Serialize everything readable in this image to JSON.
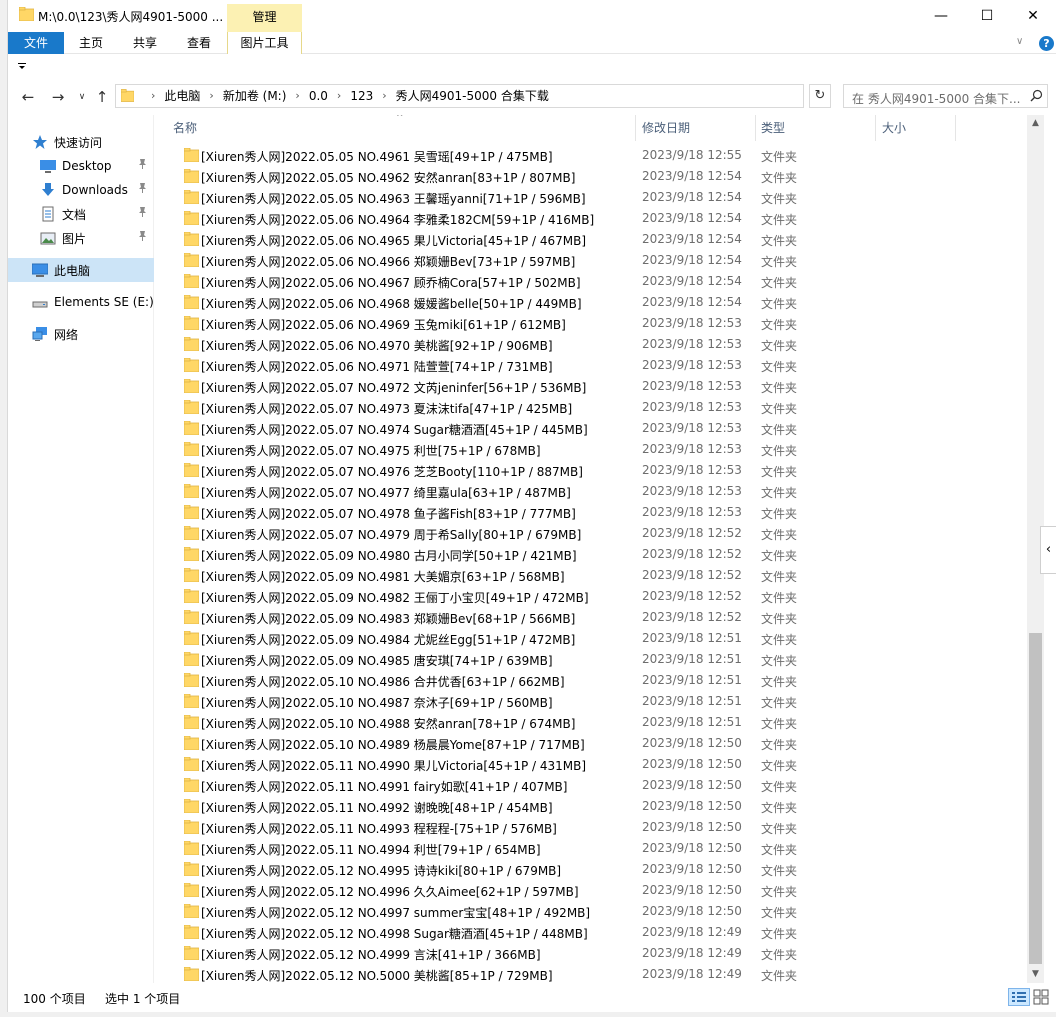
{
  "window": {
    "title": "M:\\0.0\\123\\秀人网4901-5000 ...",
    "manage_tab": "管理",
    "min": "—",
    "max": "☐",
    "close": "✕"
  },
  "ribbon": {
    "tabs": [
      "文件",
      "主页",
      "共享",
      "查看",
      "图片工具"
    ],
    "expand": "∨",
    "help": "?"
  },
  "nav": {
    "back": "←",
    "forward": "→",
    "recent": "∨",
    "up": "↑",
    "crumbs": [
      "此电脑",
      "新加卷 (M:)",
      "0.0",
      "123",
      "秀人网4901-5000 合集下载"
    ],
    "separator": "›",
    "refresh": "↻",
    "search_placeholder": "在 秀人网4901-5000 合集下..."
  },
  "sidebar": {
    "items": [
      {
        "label": "快速访问",
        "icon": "star-icon"
      },
      {
        "label": "Desktop",
        "icon": "desktop-icon"
      },
      {
        "label": "Downloads",
        "icon": "download-icon"
      },
      {
        "label": "文档",
        "icon": "document-icon"
      },
      {
        "label": "图片",
        "icon": "picture-icon"
      },
      {
        "label": "此电脑",
        "icon": "computer-icon"
      },
      {
        "label": "Elements SE (E:)",
        "icon": "drive-icon"
      },
      {
        "label": "网络",
        "icon": "network-icon"
      }
    ]
  },
  "columns": {
    "name": "名称",
    "date": "修改日期",
    "type": "类型",
    "size": "大小",
    "sort_indicator": "^"
  },
  "files": [
    {
      "name": "[Xiuren秀人网]2022.05.05 NO.4961 吴雪瑶[49+1P / 475MB]",
      "date": "2023/9/18 12:55",
      "type": "文件夹"
    },
    {
      "name": "[Xiuren秀人网]2022.05.05 NO.4962 安然anran[83+1P / 807MB]",
      "date": "2023/9/18 12:54",
      "type": "文件夹"
    },
    {
      "name": "[Xiuren秀人网]2022.05.05 NO.4963 王馨瑶yanni[71+1P / 596MB]",
      "date": "2023/9/18 12:54",
      "type": "文件夹"
    },
    {
      "name": "[Xiuren秀人网]2022.05.06 NO.4964 李雅柔182CM[59+1P / 416MB]",
      "date": "2023/9/18 12:54",
      "type": "文件夹"
    },
    {
      "name": "[Xiuren秀人网]2022.05.06 NO.4965 果儿Victoria[45+1P / 467MB]",
      "date": "2023/9/18 12:54",
      "type": "文件夹"
    },
    {
      "name": "[Xiuren秀人网]2022.05.06 NO.4966 郑颖姗Bev[73+1P / 597MB]",
      "date": "2023/9/18 12:54",
      "type": "文件夹"
    },
    {
      "name": "[Xiuren秀人网]2022.05.06 NO.4967 顾乔楠Cora[57+1P / 502MB]",
      "date": "2023/9/18 12:54",
      "type": "文件夹"
    },
    {
      "name": "[Xiuren秀人网]2022.05.06 NO.4968 媛媛酱belle[50+1P / 449MB]",
      "date": "2023/9/18 12:54",
      "type": "文件夹"
    },
    {
      "name": "[Xiuren秀人网]2022.05.06 NO.4969 玉兔miki[61+1P / 612MB]",
      "date": "2023/9/18 12:53",
      "type": "文件夹"
    },
    {
      "name": "[Xiuren秀人网]2022.05.06 NO.4970 美桃酱[92+1P / 906MB]",
      "date": "2023/9/18 12:53",
      "type": "文件夹"
    },
    {
      "name": "[Xiuren秀人网]2022.05.06 NO.4971 陆萱萱[74+1P / 731MB]",
      "date": "2023/9/18 12:53",
      "type": "文件夹"
    },
    {
      "name": "[Xiuren秀人网]2022.05.07 NO.4972 文芮jeninfer[56+1P / 536MB]",
      "date": "2023/9/18 12:53",
      "type": "文件夹"
    },
    {
      "name": "[Xiuren秀人网]2022.05.07 NO.4973 夏沫沫tifa[47+1P / 425MB]",
      "date": "2023/9/18 12:53",
      "type": "文件夹"
    },
    {
      "name": "[Xiuren秀人网]2022.05.07 NO.4974 Sugar糖酒酒[45+1P / 445MB]",
      "date": "2023/9/18 12:53",
      "type": "文件夹"
    },
    {
      "name": "[Xiuren秀人网]2022.05.07 NO.4975 利世[75+1P / 678MB]",
      "date": "2023/9/18 12:53",
      "type": "文件夹"
    },
    {
      "name": "[Xiuren秀人网]2022.05.07 NO.4976 芝芝Booty[110+1P / 887MB]",
      "date": "2023/9/18 12:53",
      "type": "文件夹"
    },
    {
      "name": "[Xiuren秀人网]2022.05.07 NO.4977 绮里嘉ula[63+1P / 487MB]",
      "date": "2023/9/18 12:53",
      "type": "文件夹"
    },
    {
      "name": "[Xiuren秀人网]2022.05.07 NO.4978 鱼子酱Fish[83+1P / 777MB]",
      "date": "2023/9/18 12:53",
      "type": "文件夹"
    },
    {
      "name": "[Xiuren秀人网]2022.05.07 NO.4979 周于希Sally[80+1P / 679MB]",
      "date": "2023/9/18 12:52",
      "type": "文件夹"
    },
    {
      "name": "[Xiuren秀人网]2022.05.09 NO.4980 古月小同学[50+1P / 421MB]",
      "date": "2023/9/18 12:52",
      "type": "文件夹"
    },
    {
      "name": "[Xiuren秀人网]2022.05.09 NO.4981 大美媚京[63+1P / 568MB]",
      "date": "2023/9/18 12:52",
      "type": "文件夹"
    },
    {
      "name": "[Xiuren秀人网]2022.05.09 NO.4982 王俪丁小宝贝[49+1P / 472MB]",
      "date": "2023/9/18 12:52",
      "type": "文件夹"
    },
    {
      "name": "[Xiuren秀人网]2022.05.09 NO.4983 郑颖姗Bev[68+1P / 566MB]",
      "date": "2023/9/18 12:52",
      "type": "文件夹"
    },
    {
      "name": "[Xiuren秀人网]2022.05.09 NO.4984 尤妮丝Egg[51+1P / 472MB]",
      "date": "2023/9/18 12:51",
      "type": "文件夹"
    },
    {
      "name": "[Xiuren秀人网]2022.05.09 NO.4985 唐安琪[74+1P / 639MB]",
      "date": "2023/9/18 12:51",
      "type": "文件夹"
    },
    {
      "name": "[Xiuren秀人网]2022.05.10 NO.4986 合井优香[63+1P / 662MB]",
      "date": "2023/9/18 12:51",
      "type": "文件夹"
    },
    {
      "name": "[Xiuren秀人网]2022.05.10 NO.4987 奈沐子[69+1P / 560MB]",
      "date": "2023/9/18 12:51",
      "type": "文件夹"
    },
    {
      "name": "[Xiuren秀人网]2022.05.10 NO.4988 安然anran[78+1P / 674MB]",
      "date": "2023/9/18 12:51",
      "type": "文件夹"
    },
    {
      "name": "[Xiuren秀人网]2022.05.10 NO.4989 杨晨晨Yome[87+1P / 717MB]",
      "date": "2023/9/18 12:50",
      "type": "文件夹"
    },
    {
      "name": "[Xiuren秀人网]2022.05.11 NO.4990 果儿Victoria[45+1P / 431MB]",
      "date": "2023/9/18 12:50",
      "type": "文件夹"
    },
    {
      "name": "[Xiuren秀人网]2022.05.11 NO.4991 fairy如歌[41+1P / 407MB]",
      "date": "2023/9/18 12:50",
      "type": "文件夹"
    },
    {
      "name": "[Xiuren秀人网]2022.05.11 NO.4992 谢晚晚[48+1P / 454MB]",
      "date": "2023/9/18 12:50",
      "type": "文件夹"
    },
    {
      "name": "[Xiuren秀人网]2022.05.11 NO.4993 程程程-[75+1P / 576MB]",
      "date": "2023/9/18 12:50",
      "type": "文件夹"
    },
    {
      "name": "[Xiuren秀人网]2022.05.11 NO.4994 利世[79+1P / 654MB]",
      "date": "2023/9/18 12:50",
      "type": "文件夹"
    },
    {
      "name": "[Xiuren秀人网]2022.05.12 NO.4995 诗诗kiki[80+1P / 679MB]",
      "date": "2023/9/18 12:50",
      "type": "文件夹"
    },
    {
      "name": "[Xiuren秀人网]2022.05.12 NO.4996 久久Aimee[62+1P / 597MB]",
      "date": "2023/9/18 12:50",
      "type": "文件夹"
    },
    {
      "name": "[Xiuren秀人网]2022.05.12 NO.4997 summer宝宝[48+1P / 492MB]",
      "date": "2023/9/18 12:50",
      "type": "文件夹"
    },
    {
      "name": "[Xiuren秀人网]2022.05.12 NO.4998 Sugar糖酒酒[45+1P / 448MB]",
      "date": "2023/9/18 12:49",
      "type": "文件夹"
    },
    {
      "name": "[Xiuren秀人网]2022.05.12 NO.4999 言沫[41+1P / 366MB]",
      "date": "2023/9/18 12:49",
      "type": "文件夹"
    },
    {
      "name": "[Xiuren秀人网]2022.05.12 NO.5000 美桃酱[85+1P / 729MB]",
      "date": "2023/9/18 12:49",
      "type": "文件夹"
    }
  ],
  "scroll": {
    "up": "▲",
    "down": "▼",
    "collapse": "‹"
  },
  "status": {
    "item_count": "100 个项目",
    "selected": "选中 1 个项目"
  },
  "colors": {
    "accent": "#1979ca",
    "folder": "#ffd766",
    "manage": "#fcf1b3",
    "selection": "#cce4f7"
  }
}
